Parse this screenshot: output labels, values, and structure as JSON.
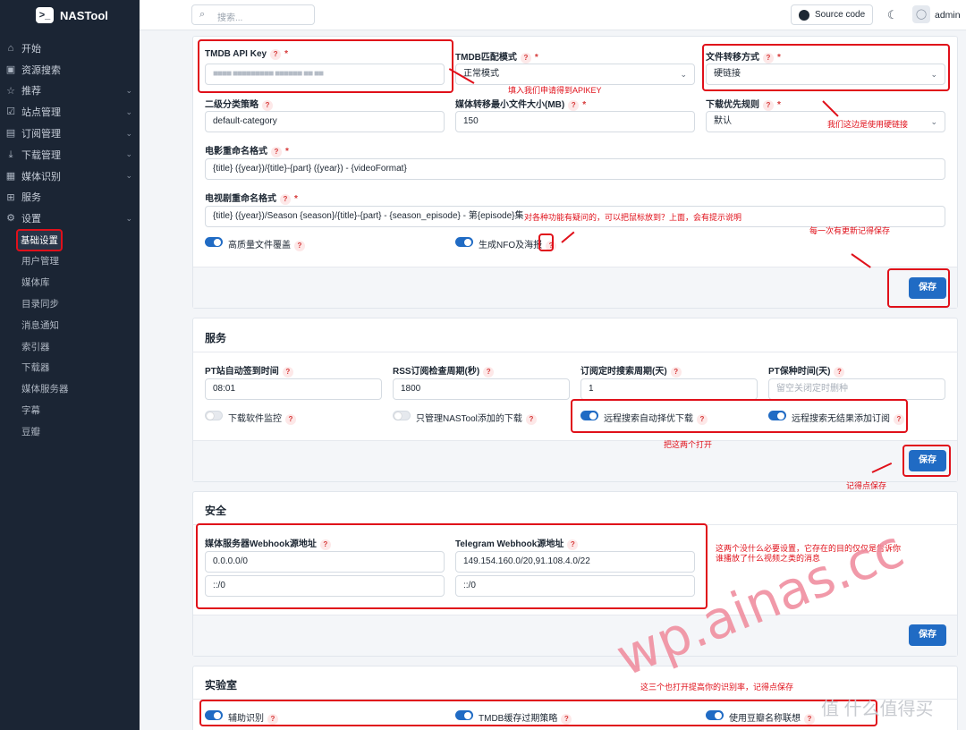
{
  "app": {
    "name": "NASTool",
    "logo_glyph": ">_"
  },
  "topbar": {
    "search_placeholder": "搜索...",
    "source_code": "Source code",
    "user": "admin"
  },
  "sidebar": {
    "items": [
      {
        "label": "开始",
        "icon": "home-icon",
        "glyph": "⌂"
      },
      {
        "label": "资源搜索",
        "icon": "box-icon",
        "glyph": "▣"
      },
      {
        "label": "推荐",
        "icon": "star-icon",
        "glyph": "☆",
        "chev": "⌄"
      },
      {
        "label": "站点管理",
        "icon": "checkbox-icon",
        "glyph": "☑",
        "chev": "⌄"
      },
      {
        "label": "订阅管理",
        "icon": "calendar-icon",
        "glyph": "▤",
        "chev": "⌄"
      },
      {
        "label": "下载管理",
        "icon": "download-icon",
        "glyph": "⤓",
        "chev": "⌄"
      },
      {
        "label": "媒体识别",
        "icon": "film-icon",
        "glyph": "▦",
        "chev": "⌄"
      },
      {
        "label": "服务",
        "icon": "apps-icon",
        "glyph": "⊞"
      },
      {
        "label": "设置",
        "icon": "gear-icon",
        "glyph": "⚙",
        "chev": "⌄"
      }
    ],
    "sub_items": [
      "基础设置",
      "用户管理",
      "媒体库",
      "目录同步",
      "消息通知",
      "索引器",
      "下载器",
      "媒体服务器",
      "字幕",
      "豆瓣"
    ]
  },
  "basic": {
    "tmdb_key": {
      "label": "TMDB API Key",
      "value": "■■■■    ■■■■■■■■■  ■■■■■■     ■■    ■■"
    },
    "tmdb_mode": {
      "label": "TMDB匹配模式",
      "value": "正常模式"
    },
    "transfer_mode": {
      "label": "文件转移方式",
      "value": "硬链接"
    },
    "category": {
      "label": "二级分类策略",
      "value": "default-category"
    },
    "min_size": {
      "label": "媒体转移最小文件大小(MB)",
      "value": "150"
    },
    "dl_priority": {
      "label": "下载优先规则",
      "value": "默认"
    },
    "movie_rename": {
      "label": "电影重命名格式",
      "value": "{title} ({year})/{title}-{part} ({year}) - {videoFormat}"
    },
    "tv_rename": {
      "label": "电视剧重命名格式",
      "value": "{title} ({year})/Season {season}/{title}-{part} - {season_episode} - 第{episode}集"
    },
    "hq_overwrite": "高质量文件覆盖",
    "gen_nfo": "生成NFO及海报",
    "save": "保存"
  },
  "service": {
    "title": "服务",
    "pt_sign": {
      "label": "PT站自动签到时间",
      "value": "08:01"
    },
    "rss": {
      "label": "RSS订阅检查周期(秒)",
      "value": "1800"
    },
    "sub_search": {
      "label": "订阅定时搜索周期(天)",
      "value": "1"
    },
    "pt_seed": {
      "label": "PT保种时间(天)",
      "placeholder": "留空关闭定时删种"
    },
    "dl_monitor": "下载软件监控",
    "only_nastool": "只管理NASTool添加的下载",
    "remote_best": "远程搜索自动择优下载",
    "remote_sub": "远程搜索无结果添加订阅",
    "save": "保存"
  },
  "security": {
    "title": "安全",
    "media_webhook": {
      "label": "媒体服务器Webhook源地址",
      "v1": "0.0.0.0/0",
      "v2": "::/0"
    },
    "tg_webhook": {
      "label": "Telegram Webhook源地址",
      "v1": "149.154.160.0/20,91.108.4.0/22",
      "v2": "::/0"
    },
    "save": "保存"
  },
  "lab": {
    "title": "实验室",
    "assist": "辅助识别",
    "tmdb_cache": "TMDB缓存过期策略",
    "douban_assoc": "使用豆瓣名称联想"
  },
  "notes": {
    "apikey": "填入我们申请得到APIKEY",
    "hardlink": "我们这边是使用硬链接",
    "tooltip": "对各种功能有疑问的，可以把鼠标放到？上面，会有提示说明",
    "save_each": "每一次有更新记得保存",
    "open_two": "把这两个打开",
    "remember_save": "记得点保存",
    "security_note": "这两个没什么必要设置，它存在的目的仅仅是告诉你\n谁播放了什么视频之类的消息",
    "lab_note": "这三个也打开提高你的识别率，记得点保存"
  },
  "watermark": "wp.ainas.cc",
  "site_mark": "值 什么值得买",
  "glyphs": {
    "q": "?",
    "req": "*",
    "caret": "⌄",
    "search": "⌕",
    "moon": "☾",
    "user": "◯"
  }
}
